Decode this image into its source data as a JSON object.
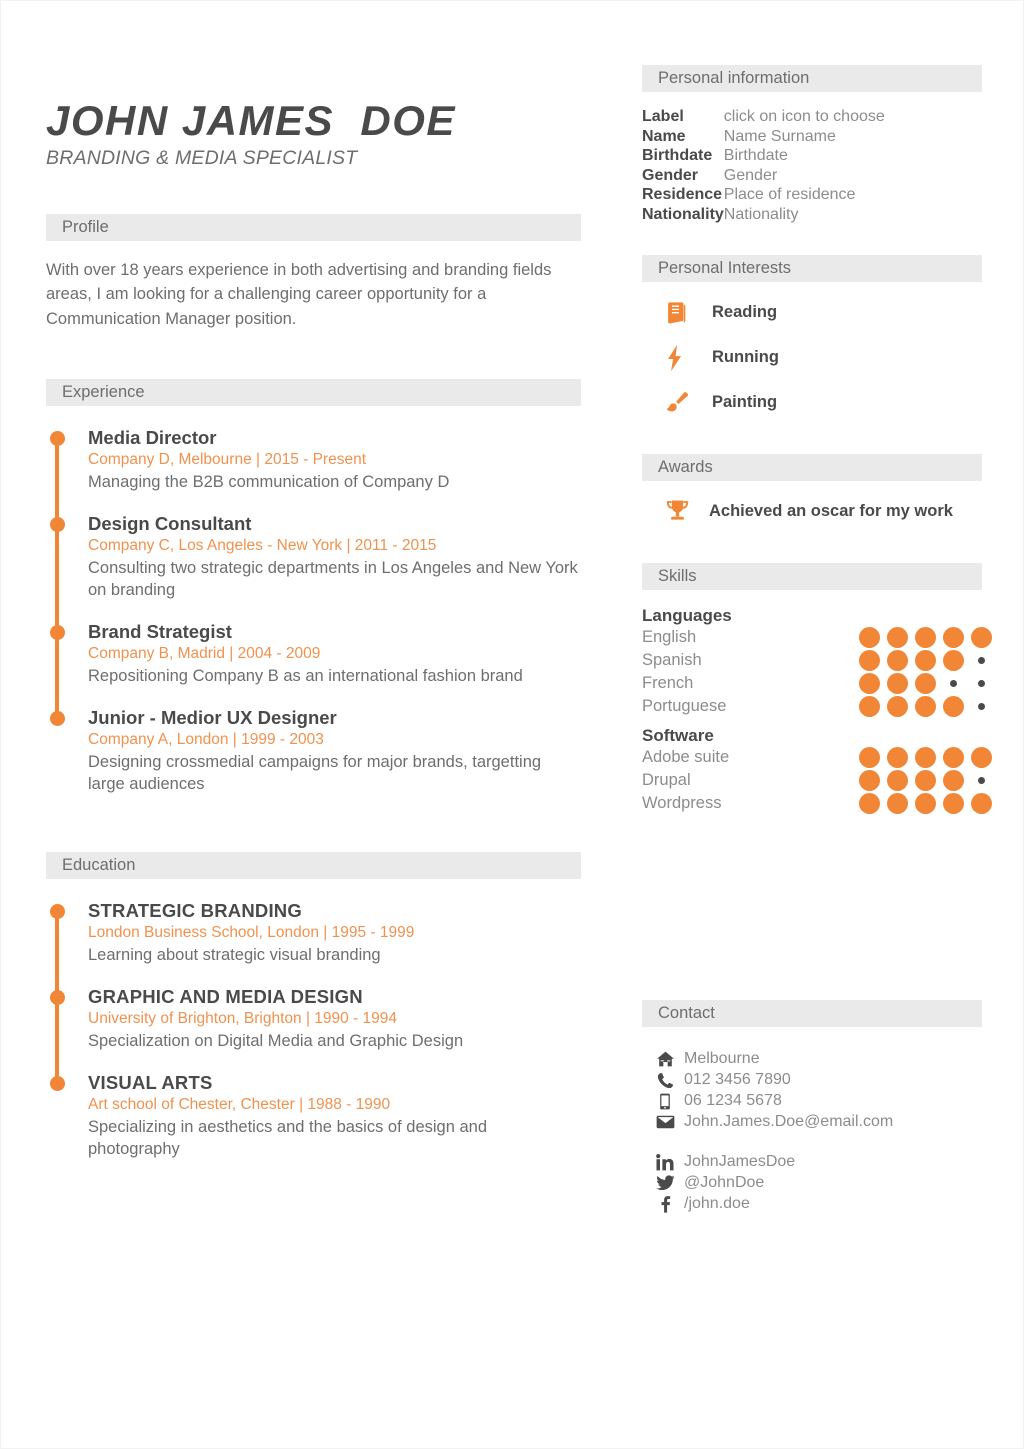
{
  "header": {
    "full_name": "JOHN JAMES  DOE",
    "job_title": "BRANDING & MEDIA SPECIALIST"
  },
  "profile": {
    "section_title": "Profile",
    "text": "With over 18 years experience in both advertising and branding fields areas, I am looking for a challenging career opportunity for a Communication Manager position."
  },
  "experience": {
    "section_title": "Experience",
    "items": [
      {
        "title": "Media Director",
        "meta": "Company D, Melbourne | 2015 - Present",
        "description": "Managing the B2B communication of Company D"
      },
      {
        "title": "Design Consultant",
        "meta": "Company C, Los Angeles - New York | 2011 - 2015",
        "description": "Consulting two strategic departments in Los Angeles and New York on branding"
      },
      {
        "title": "Brand Strategist",
        "meta": "Company B, Madrid | 2004 - 2009",
        "description": "Repositioning Company B as an international fashion brand"
      },
      {
        "title": "Junior - Medior UX Designer",
        "meta": "Company A, London | 1999 - 2003",
        "description": "Designing crossmedial campaigns for major brands, targetting large audiences"
      }
    ]
  },
  "education": {
    "section_title": "Education",
    "items": [
      {
        "title": "STRATEGIC BRANDING",
        "meta": "London Business School, London | 1995 - 1999",
        "description": "Learning about strategic visual branding"
      },
      {
        "title": "GRAPHIC AND MEDIA DESIGN",
        "meta": "University of Brighton, Brighton | 1990 - 1994",
        "description": "Specialization on Digital Media and Graphic Design"
      },
      {
        "title": "VISUAL ARTS",
        "meta": "Art school of Chester, Chester | 1988 - 1990",
        "description": "Specializing in aesthetics and the basics of design and photography"
      }
    ]
  },
  "personal_information": {
    "section_title": "Personal information",
    "rows": [
      {
        "label": "Label",
        "value": "click on icon to choose"
      },
      {
        "label": "Name",
        "value": "Name Surname"
      },
      {
        "label": "Birthdate",
        "value": "Birthdate"
      },
      {
        "label": "Gender",
        "value": "Gender"
      },
      {
        "label": "Residence",
        "value": "Place of residence"
      },
      {
        "label": "Nationality",
        "value": "Nationality"
      }
    ]
  },
  "personal_interests": {
    "section_title": "Personal Interests",
    "items": [
      {
        "label": "Reading",
        "icon": "book-icon"
      },
      {
        "label": "Running",
        "icon": "lightning-bolt-icon"
      },
      {
        "label": "Painting",
        "icon": "paintbrush-icon"
      }
    ]
  },
  "awards": {
    "section_title": "Awards",
    "items": [
      {
        "label": "Achieved an oscar for my work",
        "icon": "trophy-icon"
      }
    ]
  },
  "skills": {
    "section_title": "Skills",
    "groups": [
      {
        "title": "Languages",
        "max": 5,
        "items": [
          {
            "name": "English",
            "level": 5
          },
          {
            "name": "Spanish",
            "level": 4
          },
          {
            "name": "French",
            "level": 3
          },
          {
            "name": "Portuguese",
            "level": 4
          }
        ]
      },
      {
        "title": "Software",
        "max": 5,
        "items": [
          {
            "name": "Adobe suite",
            "level": 5
          },
          {
            "name": "Drupal",
            "level": 4
          },
          {
            "name": "Wordpress",
            "level": 5
          }
        ]
      }
    ]
  },
  "contact": {
    "section_title": "Contact",
    "primary": [
      {
        "icon": "home-icon",
        "text": "Melbourne"
      },
      {
        "icon": "phone-icon",
        "text": "012 3456 7890"
      },
      {
        "icon": "mobile-icon",
        "text": "06 1234 5678"
      },
      {
        "icon": "envelope-icon",
        "text": "John.James.Doe@email.com"
      }
    ],
    "social": [
      {
        "icon": "linkedin-icon",
        "text": "JohnJamesDoe"
      },
      {
        "icon": "twitter-icon",
        "text": "@JohnDoe"
      },
      {
        "icon": "facebook-icon",
        "text": "/john.doe"
      }
    ]
  },
  "colors": {
    "accent": "#f08636",
    "accent_text": "#f0924f",
    "bar_bg": "#eaeaea",
    "heading": "#4a4a4a",
    "body_text": "#6d6e70",
    "muted_text": "#8b8c8e"
  }
}
